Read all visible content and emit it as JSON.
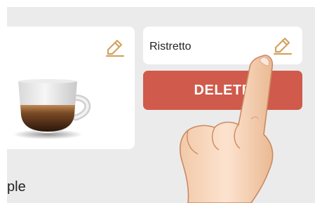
{
  "cards": {
    "left": {
      "edit_icon": "pencil-icon",
      "image": "espresso-cup-image"
    },
    "right": {
      "name": "Ristretto",
      "edit_icon": "pencil-icon"
    }
  },
  "actions": {
    "delete_label": "DELETE"
  },
  "partial_label": "ple",
  "colors": {
    "background": "#ebebeb",
    "card": "#ffffff",
    "delete_button": "#d05a4b",
    "icon_accent": "#d4a261"
  },
  "overlay": {
    "image": "pointing-hand"
  }
}
